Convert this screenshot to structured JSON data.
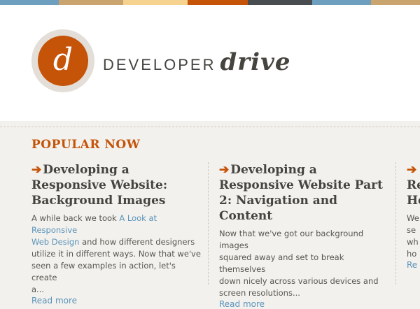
{
  "colors": {
    "accent": "#c55308",
    "link": "#5b93b9",
    "text": "#45443f",
    "background": "#f2f1ed",
    "topbar": [
      "#6e9fbf",
      "#c9a46f",
      "#f6d290",
      "#c55308",
      "#4a4d4f",
      "#6e9fbf",
      "#c9a46f"
    ]
  },
  "logo": {
    "letter": "d"
  },
  "brand": {
    "part_a": "DEVELOPER",
    "part_b": "drive"
  },
  "section": {
    "title": "POPULAR NOW"
  },
  "icons": {
    "arrow": "right-arrow-icon"
  },
  "posts": [
    {
      "title_line1": "Developing a",
      "title_line2": "Responsive Website:",
      "title_line3": "Background Images",
      "excerpt_line1_a": "A while back we took ",
      "excerpt_link1": "A Look at Responsive",
      "excerpt_link2": "Web Design",
      "excerpt_line2_b": " and how different designers",
      "excerpt_line3": "utilize it in different ways.  Now that we've",
      "excerpt_line4": "seen a few examples in action, let's create",
      "excerpt_line5": "a...",
      "read_more": "Read more"
    },
    {
      "title_line1": "Developing a",
      "title_line2": "Responsive Website Part",
      "title_line3": "2: Navigation and Content",
      "excerpt_line1": "Now that we've got our background images",
      "excerpt_line2": "squared away and set to break themselves",
      "excerpt_line3": "down nicely across various devices and",
      "excerpt_line4": "screen resolutions...",
      "read_more": "Read more"
    },
    {
      "title_line1": "",
      "title_line2": "Re",
      "title_line3": "He",
      "excerpt_line1": "We",
      "excerpt_line2": "se",
      "excerpt_line3": "wh",
      "excerpt_line4": "ho",
      "read_more": "Re"
    }
  ]
}
